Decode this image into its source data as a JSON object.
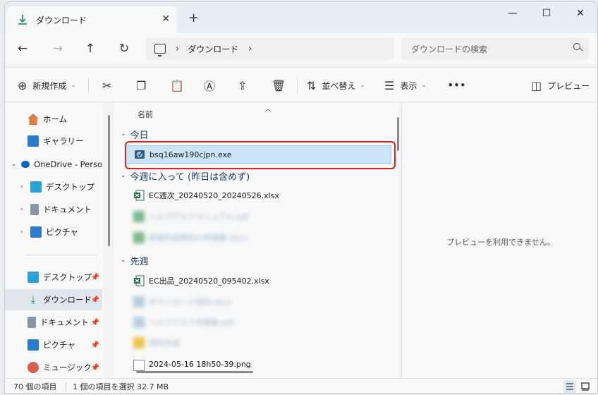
{
  "tab": {
    "title": "ダウンロード"
  },
  "window_controls": {
    "minimize": "—",
    "maximize": "☐",
    "close": "✕",
    "new_tab": "+"
  },
  "address": {
    "segment": "ダウンロード"
  },
  "search": {
    "placeholder": "ダウンロードの検索"
  },
  "toolbar": {
    "new_label": "新規作成",
    "sort_label": "並べ替え",
    "view_label": "表示",
    "more_label": "•••",
    "preview_label": "プレビュー"
  },
  "nav": {
    "home": "ホーム",
    "gallery": "ギャラリー",
    "onedrive": "OneDrive - Perso",
    "desktop": "デスクトップ",
    "documents": "ドキュメント",
    "pictures": "ピクチャ",
    "quick_desktop": "デスクトップ",
    "quick_downloads": "ダウンロード",
    "quick_documents": "ドキュメント",
    "quick_pictures": "ピクチャ",
    "quick_music": "ミュージック"
  },
  "filelist": {
    "column_name": "名前",
    "groups": {
      "today": "今日",
      "this_week": "今週に入って (昨日は含めず)",
      "last_week": "先週"
    },
    "files": {
      "exe": "bsq16aw190cjpn.exe",
      "xlsx1": "EC週次_20240520_20240526.xlsx",
      "blur1": "ヘルプデスクマニュアル.pdf",
      "blur2": "新規作成資料の申請書.docx",
      "xlsx2": "EC出品_20240520_095402.xlsx",
      "blur3": "ダウンロード資料.docx",
      "blur4": "ヘルプデスク手順書.pdf",
      "blur5": "資料作成",
      "png": "2024-05-16 18h50-39.png"
    }
  },
  "preview": {
    "message": "プレビューを利用できません。"
  },
  "status": {
    "count": "70 個の項目",
    "selection": "1 個の項目を選択  32.7 MB"
  },
  "colors": {
    "accent": "#0067c0",
    "selection": "#cce4f7",
    "highlight_box": "#e02020",
    "excel": "#1d6f42",
    "download": "#1a9f5c"
  }
}
